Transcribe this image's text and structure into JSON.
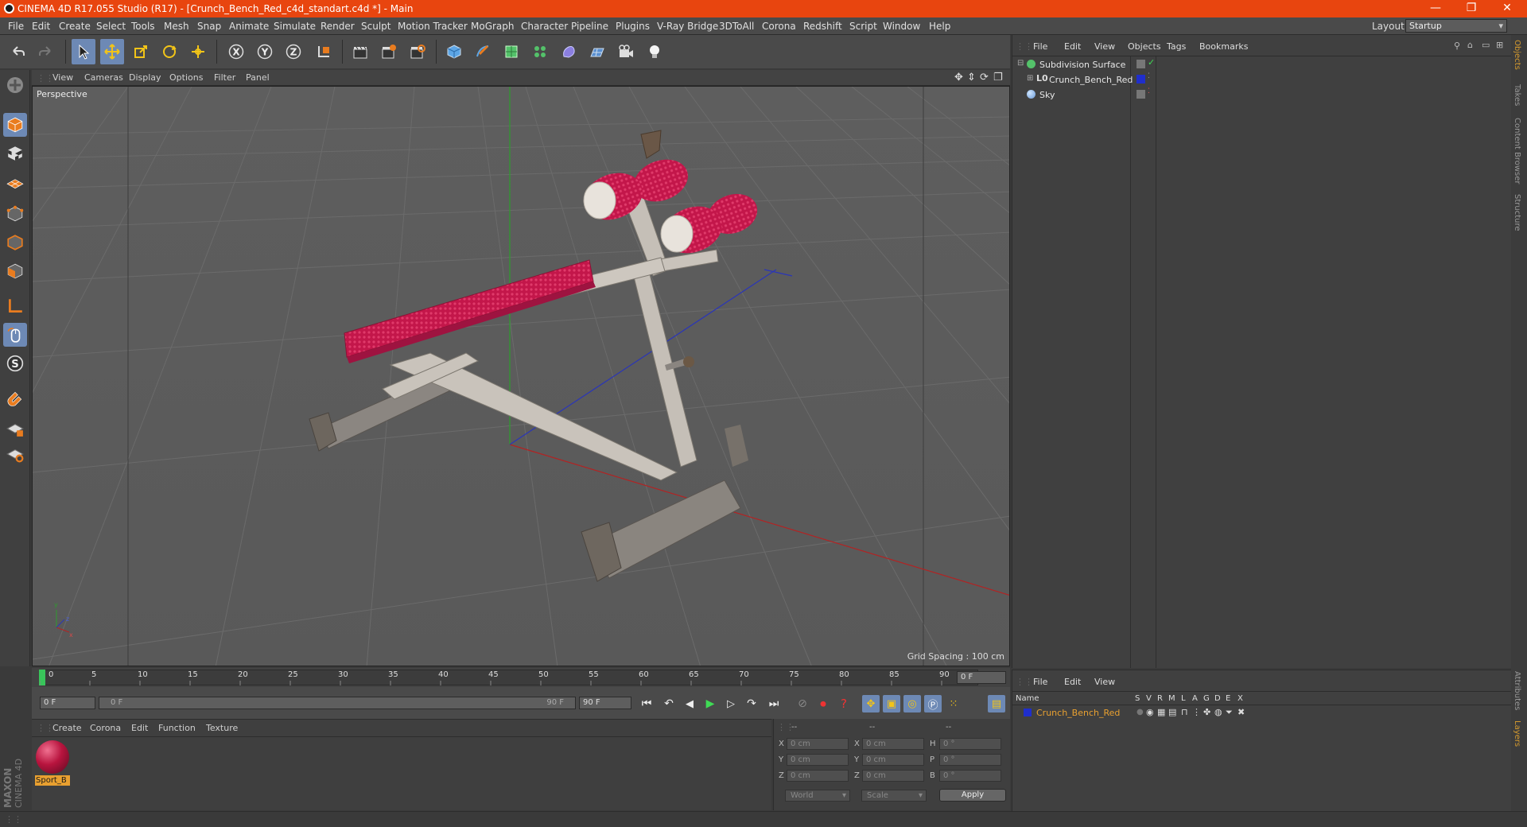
{
  "window": {
    "title": "CINEMA 4D R17.055 Studio (R17) - [Crunch_Bench_Red_c4d_standart.c4d *] - Main",
    "minimize": "—",
    "restore": "❐",
    "close": "✕"
  },
  "menubar": {
    "items": [
      "File",
      "Edit",
      "Create",
      "Select",
      "Tools",
      "Mesh",
      "Snap",
      "Animate",
      "Simulate",
      "Render",
      "Sculpt",
      "Motion Tracker",
      "MoGraph",
      "Character",
      "Pipeline",
      "Plugins",
      "V-Ray Bridge",
      "3DToAll",
      "Corona",
      "Redshift",
      "Script",
      "Window",
      "Help"
    ],
    "layout_label": "Layout:",
    "layout_value": "Startup"
  },
  "viewport": {
    "menu": [
      "View",
      "Cameras",
      "Display",
      "Options",
      "Filter",
      "Panel"
    ],
    "label": "Perspective",
    "grid_spacing": "Grid Spacing : 100 cm"
  },
  "timeline": {
    "ticks": [
      "0",
      "5",
      "10",
      "15",
      "20",
      "25",
      "30",
      "35",
      "40",
      "45",
      "50",
      "55",
      "60",
      "65",
      "70",
      "75",
      "80",
      "85",
      "90"
    ],
    "current_frame": "0 F",
    "start_field": "0 F",
    "range_start": "0 F",
    "range_end": "90 F",
    "end_field": "90 F"
  },
  "material_panel": {
    "menu": [
      "Create",
      "Corona",
      "Edit",
      "Function",
      "Texture"
    ],
    "materials": [
      {
        "name": "Sport_B"
      }
    ]
  },
  "coordinates": {
    "headers": [
      "--",
      "--",
      "--"
    ],
    "rows": [
      {
        "a": "X",
        "av": "0 cm",
        "b": "X",
        "bv": "0 cm",
        "c": "H",
        "cv": "0 °"
      },
      {
        "a": "Y",
        "av": "0 cm",
        "b": "Y",
        "bv": "0 cm",
        "c": "P",
        "cv": "0 °"
      },
      {
        "a": "Z",
        "av": "0 cm",
        "b": "Z",
        "bv": "0 cm",
        "c": "B",
        "cv": "0 °"
      }
    ],
    "mode": "World",
    "mode2": "Scale",
    "apply": "Apply"
  },
  "object_manager": {
    "menu": [
      "File",
      "Edit",
      "View",
      "Objects",
      "Tags",
      "Bookmarks"
    ],
    "objects": [
      {
        "name": "Subdivision Surface"
      },
      {
        "name": "Crunch_Bench_Red"
      },
      {
        "name": "Sky"
      }
    ]
  },
  "layers_manager": {
    "menu": [
      "File",
      "Edit",
      "View"
    ],
    "columns": [
      "Name",
      "S",
      "V",
      "R",
      "M",
      "L",
      "A",
      "G",
      "D",
      "E",
      "X"
    ],
    "layers": [
      {
        "name": "Crunch_Bench_Red",
        "color": "#1f2ecc"
      }
    ]
  },
  "right_tabs": [
    "Objects",
    "Takes",
    "Content Browser",
    "Structure"
  ],
  "right_tabs_bottom": [
    "Attributes",
    "Layers"
  ],
  "branding": {
    "maxon": "MAXON",
    "c4d": "CINEMA 4D"
  },
  "colors": {
    "accent": "#e8450f",
    "selected": "#6d89b5",
    "layer_text": "#e8a030"
  }
}
